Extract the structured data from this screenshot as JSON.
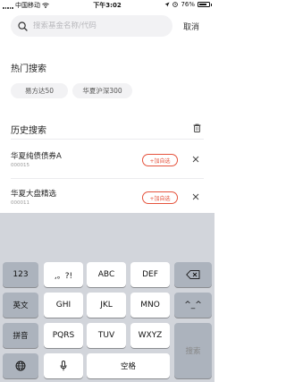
{
  "status_bar": {
    "carrier": "中国移动",
    "time": "下午3:02",
    "battery": "76%"
  },
  "search": {
    "placeholder": "搜索基金名称/代码",
    "value": "",
    "cancel_label": "取消"
  },
  "hot_search": {
    "title": "热门搜索",
    "chips": [
      "易方达50",
      "华夏沪深300"
    ]
  },
  "history": {
    "title": "历史搜索",
    "items": [
      {
        "name": "华夏纯债债券A",
        "code": "000015",
        "add_label": "+加自选"
      },
      {
        "name": "华夏大盘精选",
        "code": "000011",
        "add_label": "+加自选"
      }
    ]
  },
  "keyboard": {
    "row1": [
      "123",
      ",。?!",
      "ABC",
      "DEF"
    ],
    "row2": [
      "英文",
      "GHI",
      "JKL",
      "MNO",
      "^_^"
    ],
    "row3": [
      "拼音",
      "PQRS",
      "TUV",
      "WXYZ"
    ],
    "space_label": "空格",
    "search_label": "搜索"
  },
  "colors": {
    "accent": "#e5533d",
    "keyboard_bg": "#d2d5db",
    "key_dark": "#acb3bd"
  }
}
